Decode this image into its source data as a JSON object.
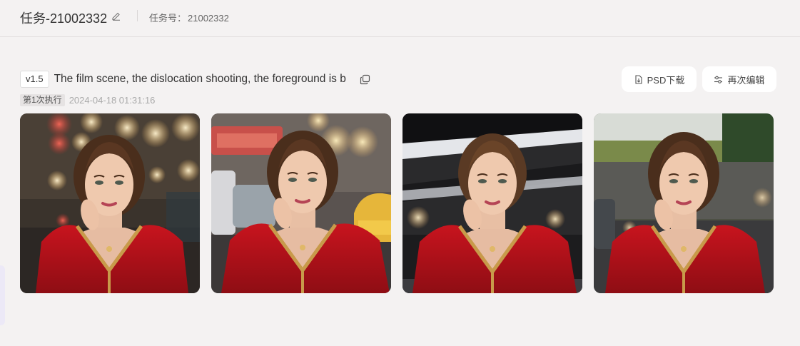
{
  "header": {
    "task_title": "任务-21002332",
    "task_no_label": "任务号：",
    "task_no_value": "21002332"
  },
  "prompt": {
    "version": "v1.5",
    "text": "The film scene, the dislocation shooting, the foreground is b"
  },
  "actions": {
    "psd_download": "PSD下载",
    "re_edit": "再次编辑"
  },
  "execution": {
    "badge": "第1次执行",
    "timestamp": "2024-04-18 01:31:16"
  },
  "images": [
    {
      "name": "generated-image-1",
      "bg": "#3a332c"
    },
    {
      "name": "generated-image-2",
      "bg": "#4a4440"
    },
    {
      "name": "generated-image-3",
      "bg": "#2a2a2c"
    },
    {
      "name": "generated-image-4",
      "bg": "#4d5044"
    }
  ],
  "icons": [
    "edit-icon",
    "copy-icon",
    "download-icon",
    "sliders-icon"
  ],
  "colors": {
    "background": "#f4f2f2",
    "button_bg": "#ffffff",
    "dress_red": "#b5121b"
  }
}
